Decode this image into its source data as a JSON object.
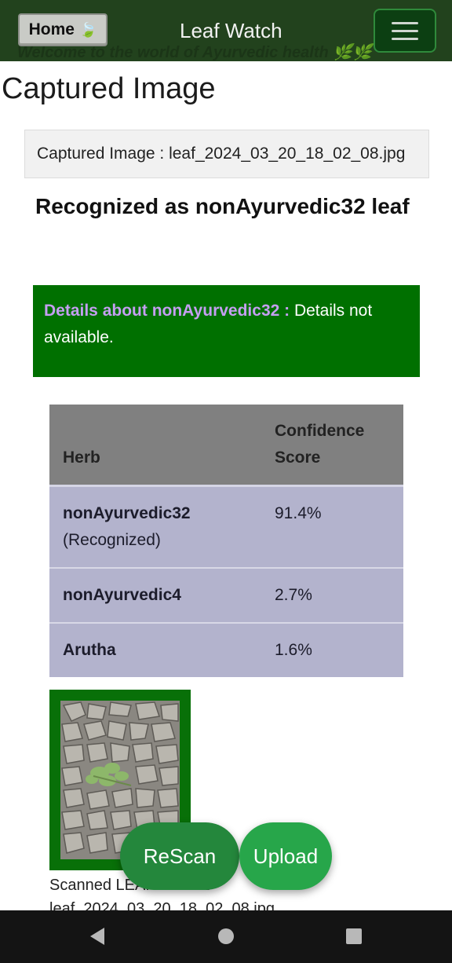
{
  "header": {
    "home_label": "Home",
    "home_icon": "leaf-icon",
    "brand": "Leaf Watch",
    "tagline": "Welcome to the world of Ayurvedic health 🌿🌿",
    "menu_icon": "hamburger-menu-icon"
  },
  "page_title": "Captured Image",
  "file_label": "Captured Image : leaf_2024_03_20_18_02_08.jpg",
  "recognized_text": "Recognized as nonAyurvedic32 leaf",
  "details": {
    "label": "Details about nonAyurvedic32 :",
    "text": " Details not available."
  },
  "table": {
    "headers": [
      "Herb",
      "Confidence Score"
    ],
    "rows": [
      {
        "herb": "nonAyurvedic32",
        "note": "(Recognized)",
        "score": "91.4%"
      },
      {
        "herb": "nonAyurvedic4",
        "note": "",
        "score": "2.7%"
      },
      {
        "herb": "Arutha",
        "note": "",
        "score": "1.6%"
      }
    ]
  },
  "caption": {
    "line1": "Scanned LEAF IMAGE",
    "line2": "leaf_2024_03_20_18_02_08.jpg"
  },
  "actions": {
    "rescan_label": "ReScan",
    "upload_label": "Upload"
  },
  "colors": {
    "header_bg": "#22421d",
    "details_bg": "#007000",
    "accent_button": "#27a64a"
  }
}
